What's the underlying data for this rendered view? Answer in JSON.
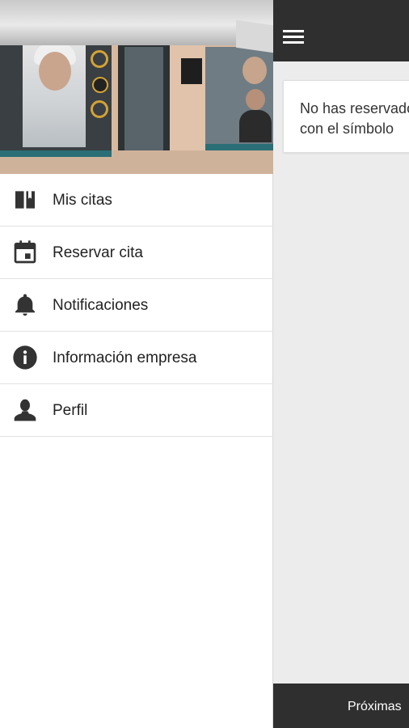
{
  "colors": {
    "bar_background": "#2f2f2f",
    "content_background": "#ececec",
    "drawer_background": "#ffffff",
    "icon_color": "#333333",
    "text_color": "#222222"
  },
  "main": {
    "notice_text": "No has reservado\ncon el símbolo",
    "bottom_tab_label": "Próximas"
  },
  "drawer": {
    "header_image": "storefront-photo",
    "items": [
      {
        "label": "Mis citas",
        "icon": "book-icon"
      },
      {
        "label": "Reservar cita",
        "icon": "calendar-icon"
      },
      {
        "label": "Notificaciones",
        "icon": "bell-icon"
      },
      {
        "label": "Información empresa",
        "icon": "info-icon"
      },
      {
        "label": "Perfil",
        "icon": "person-icon"
      }
    ]
  }
}
